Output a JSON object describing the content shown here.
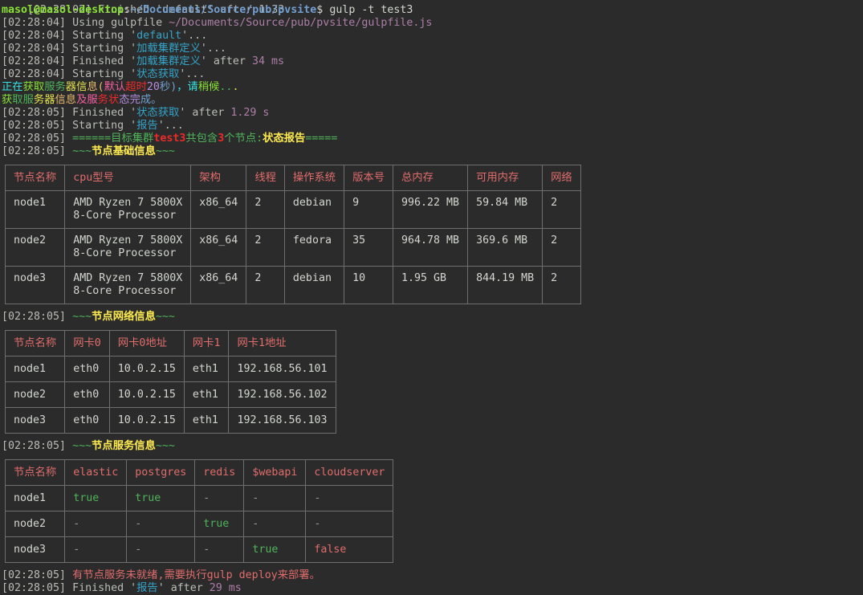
{
  "prompt": {
    "prev_line": "[02:28:02] Finished 'default' after 1.33 s",
    "user_host": "masol@masol-desktop",
    "sep": ":",
    "path": "~/Documents/Source/pub/pvsite",
    "sign": "$",
    "command": " gulp -t test3"
  },
  "log_top": {
    "ts": "[02:28:04]",
    "using_word": " Using gulpfile ",
    "gulpfile_path": "~/Documents/Source/pub/pvsite/gulpfile.js",
    "starting_word": " Starting '",
    "finished_word": " Finished '",
    "close_quote": "'...",
    "after_word": "' after ",
    "task_default": "default",
    "task_load": "加载集群定义",
    "task_load_time": "34 ms",
    "task_status": "状态获取"
  },
  "rainbow": {
    "fetching": "正在获取服务器信息(默认超时20秒)，请稍候...",
    "fetched": "获取服务器信息及服务状态完成。"
  },
  "log_mid": {
    "ts": "[02:28:05]",
    "status_time": "1.29 s",
    "task_report": "报告",
    "banner_left": "======目标集群",
    "cluster": "test3",
    "banner_mid1": "共包含",
    "node_count": "3",
    "banner_mid2": "个节点:",
    "banner_title": "状态报告",
    "banner_right": "=====",
    "tilde": "~~~",
    "section_basic": "节点基础信息",
    "section_net": "节点网络信息",
    "section_svc": "节点服务信息"
  },
  "table_basic": {
    "headers": [
      "节点名称",
      "cpu型号",
      "架构",
      "线程",
      "操作系统",
      "版本号",
      "总内存",
      "可用内存",
      "网络"
    ],
    "rows": [
      [
        "node1",
        "AMD Ryzen 7 5800X\n8-Core Processor",
        "x86_64",
        "2",
        "debian",
        "9",
        "996.22 MB",
        "59.84 MB",
        "2"
      ],
      [
        "node2",
        "AMD Ryzen 7 5800X\n8-Core Processor",
        "x86_64",
        "2",
        "fedora",
        "35",
        "964.78 MB",
        "369.6 MB",
        "2"
      ],
      [
        "node3",
        "AMD Ryzen 7 5800X\n8-Core Processor",
        "x86_64",
        "2",
        "debian",
        "10",
        "1.95 GB",
        "844.19 MB",
        "2"
      ]
    ]
  },
  "table_net": {
    "headers": [
      "节点名称",
      "网卡0",
      "网卡0地址",
      "网卡1",
      "网卡1地址"
    ],
    "rows": [
      [
        "node1",
        "eth0",
        "10.0.2.15",
        "eth1",
        "192.168.56.101"
      ],
      [
        "node2",
        "eth0",
        "10.0.2.15",
        "eth1",
        "192.168.56.102"
      ],
      [
        "node3",
        "eth0",
        "10.0.2.15",
        "eth1",
        "192.168.56.103"
      ]
    ]
  },
  "table_svc": {
    "headers": [
      "节点名称",
      "elastic",
      "postgres",
      "redis",
      "$webapi",
      "cloudserver"
    ],
    "rows": [
      [
        "node1",
        "true",
        "true",
        "-",
        "-",
        "-"
      ],
      [
        "node2",
        "-",
        "-",
        "true",
        "-",
        "-"
      ],
      [
        "node3",
        "-",
        "-",
        "-",
        "true",
        "false"
      ]
    ]
  },
  "log_bottom": {
    "ts": "[02:28:05]",
    "warn": "有节点服务未就绪,需要执行gulp deploy来部署。",
    "finished_word": " Finished '",
    "task_report": "报告",
    "after_word": "' after ",
    "report_time": "29 ms"
  },
  "colors": {
    "background": "#2b2b2b",
    "header_red": "#e06c6c",
    "true_green": "#4eb35a",
    "prompt_green": "#8ae234",
    "path_blue": "#729fcf",
    "task_cyan": "#34a4c8",
    "time_magenta": "#ad7fa8",
    "title_yellow": "#fce94f"
  }
}
